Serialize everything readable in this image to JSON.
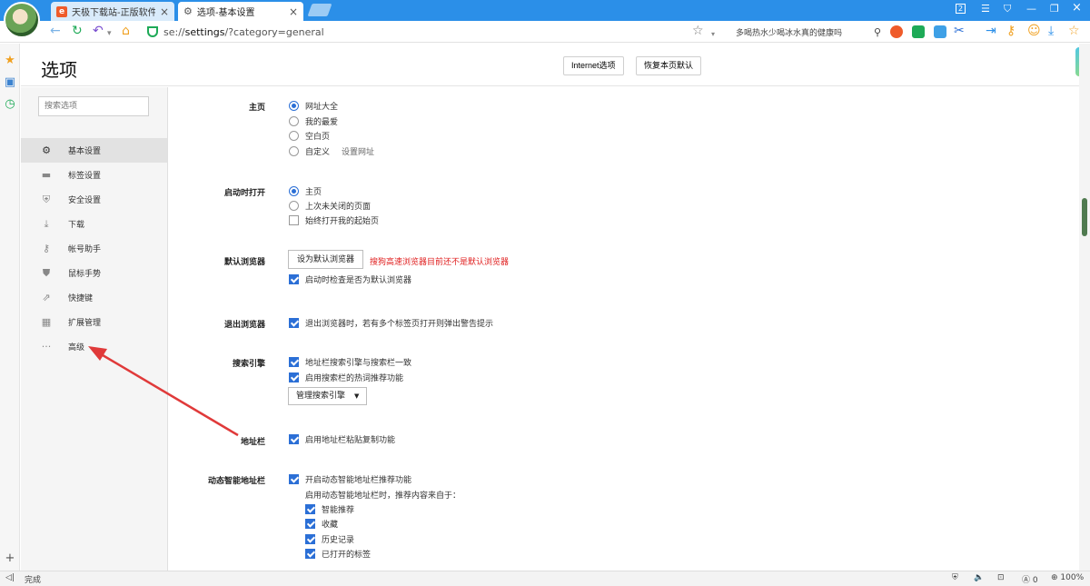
{
  "tabs": [
    {
      "label": "天极下载站-正版软件下载"
    },
    {
      "label": "选项-基本设置"
    }
  ],
  "window": {
    "badge": "2"
  },
  "address": {
    "prefix": "se://",
    "host": "settings",
    "path": "/?category=general"
  },
  "toolbar_search": {
    "text": "多喝热水少喝冰水真的健康吗"
  },
  "header": {
    "title": "选项",
    "internet_options": "Internet选项",
    "restore_defaults": "恢复本页默认"
  },
  "sidebar": {
    "search_placeholder": "搜索选项",
    "items": [
      {
        "label": "基本设置",
        "icon": "gear-icon"
      },
      {
        "label": "标签设置",
        "icon": "laptop-icon"
      },
      {
        "label": "安全设置",
        "icon": "shield-check-icon"
      },
      {
        "label": "下载",
        "icon": "download-icon"
      },
      {
        "label": "帐号助手",
        "icon": "key-icon"
      },
      {
        "label": "鼠标手势",
        "icon": "shield-icon"
      },
      {
        "label": "快捷键",
        "icon": "arrow-out-icon"
      },
      {
        "label": "扩展管理",
        "icon": "grid-icon"
      },
      {
        "label": "高级",
        "icon": "more-icon"
      }
    ]
  },
  "settings": {
    "homepage": {
      "label": "主页",
      "options": [
        "网址大全",
        "我的最爱",
        "空白页",
        "自定义"
      ],
      "custom_link": "设置网址",
      "selected": "网址大全"
    },
    "startup": {
      "label": "启动时打开",
      "options": [
        "主页",
        "上次未关闭的页面"
      ],
      "checkbox": "始终打开我的起始页",
      "selected": "主页",
      "checked": false
    },
    "default_browser": {
      "label": "默认浏览器",
      "button": "设为默认浏览器",
      "warning": "搜狗高速浏览器目前还不是默认浏览器",
      "checkbox": "启动时检查是否为默认浏览器"
    },
    "exit": {
      "label": "退出浏览器",
      "checkbox": "退出浏览器时，若有多个标签页打开则弹出警告提示"
    },
    "search_engine": {
      "label": "搜索引擎",
      "checkboxes": [
        "地址栏搜索引擎与搜索栏一致",
        "启用搜索栏的热词推荐功能"
      ],
      "manage": "管理搜索引擎"
    },
    "address_bar": {
      "label": "地址栏",
      "checkbox": "启用地址栏粘贴复制功能"
    },
    "smart_bar": {
      "label": "动态智能地址栏",
      "checkbox": "开启动态智能地址栏推荐功能",
      "note": "启用动态智能地址栏时，推荐内容来自于：",
      "sources": [
        "智能推荐",
        "收藏",
        "历史记录",
        "已打开的标签"
      ]
    }
  },
  "status": {
    "text": "完成",
    "blocked": "0",
    "zoom": "100%"
  },
  "colors": {
    "titlebar": "#2b8fe8",
    "accent": "#2b6fd6",
    "warning": "#e02020",
    "annotation_arrow": "#e03a3a"
  }
}
